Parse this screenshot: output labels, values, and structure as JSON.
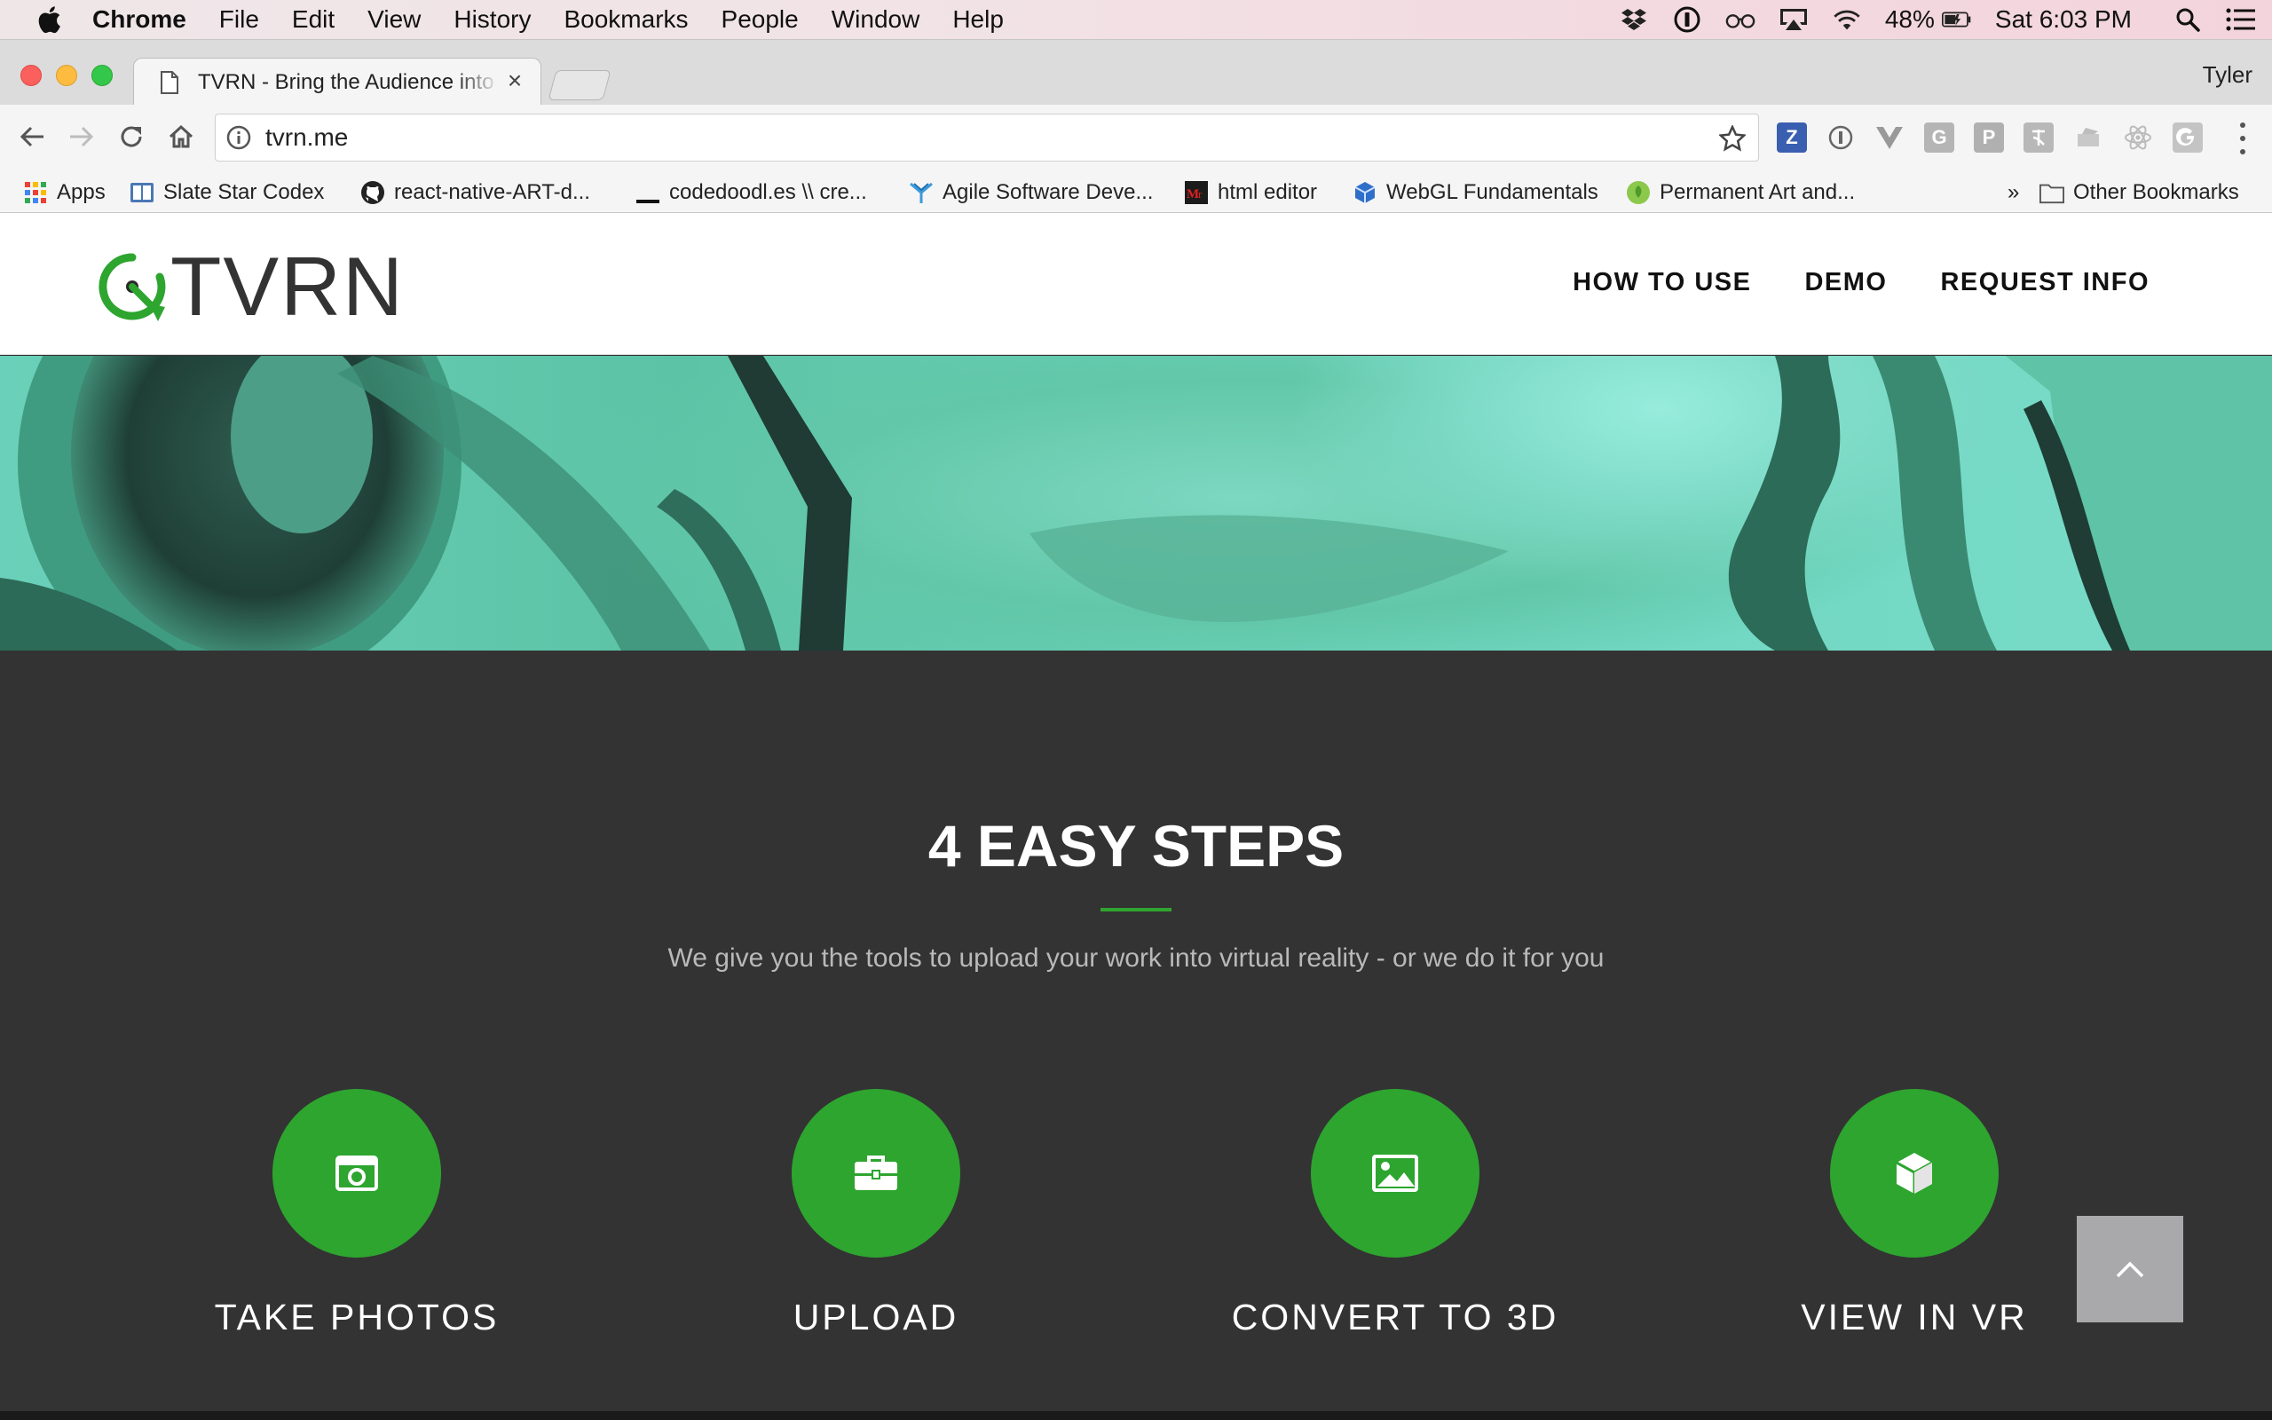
{
  "menubar": {
    "app_name": "Chrome",
    "items": [
      "File",
      "Edit",
      "View",
      "History",
      "Bookmarks",
      "People",
      "Window",
      "Help"
    ],
    "battery": "48%",
    "clock": "Sat 6:03 PM"
  },
  "browser": {
    "tab_title": "TVRN - Bring the Audience into VR",
    "profile_name": "Tyler",
    "url": "tvrn.me",
    "bookmarks": [
      {
        "label": "Apps",
        "icon": "apps-grid-icon"
      },
      {
        "label": "Slate Star Codex",
        "icon": "book-icon"
      },
      {
        "label": "react-native-ART-d...",
        "icon": "github-icon"
      },
      {
        "label": "codedoodl.es \\\\ cre...",
        "icon": "underscore-icon"
      },
      {
        "label": "Agile Software Deve...",
        "icon": "agile-icon"
      },
      {
        "label": "html editor",
        "icon": "editor-icon"
      },
      {
        "label": "WebGL Fundamentals",
        "icon": "cube-icon"
      },
      {
        "label": "Permanent Art and...",
        "icon": "leaf-icon"
      }
    ],
    "overflow": "»",
    "other_bookmarks": "Other Bookmarks",
    "extension_letters": {
      "z": "Z",
      "g": "G",
      "p": "P"
    }
  },
  "site": {
    "logo_text": "TVRN",
    "nav": [
      "HOW TO USE",
      "DEMO",
      "REQUEST INFO"
    ],
    "steps_heading": "4 EASY STEPS",
    "steps_subtitle": "We give you the tools to upload your work into virtual reality - or we do it for you",
    "steps": [
      {
        "label": "TAKE PHOTOS",
        "icon": "camera-icon"
      },
      {
        "label": "UPLOAD",
        "icon": "briefcase-icon"
      },
      {
        "label": "CONVERT TO 3D",
        "icon": "image-icon"
      },
      {
        "label": "VIEW IN VR",
        "icon": "cube-icon"
      }
    ],
    "accent_color": "#2da52f"
  }
}
